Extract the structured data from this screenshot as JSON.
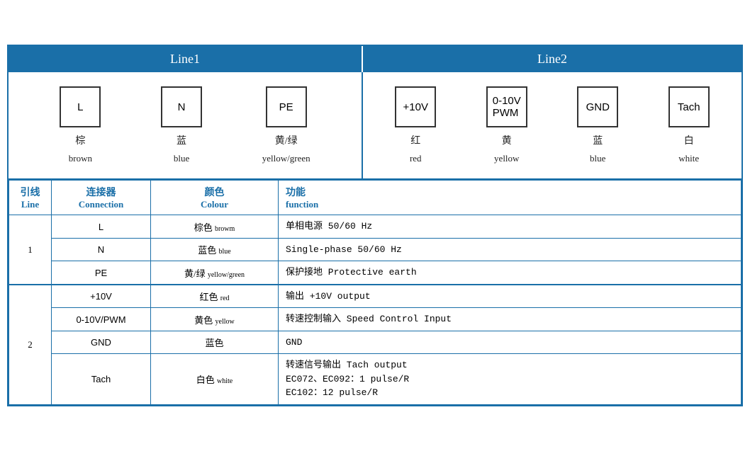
{
  "header": {
    "line1_label": "Line1",
    "line2_label": "Line2"
  },
  "diagram": {
    "line1_connectors": [
      {
        "id": "L",
        "label_zh": "棕",
        "label_en": "brown"
      },
      {
        "id": "N",
        "label_zh": "蓝",
        "label_en": "blue"
      },
      {
        "id": "PE",
        "label_zh": "黄/绿",
        "label_en": "yellow/green"
      }
    ],
    "line2_connectors": [
      {
        "id": "+10V",
        "label_zh": "红",
        "label_en": "red"
      },
      {
        "id": "0-10V\nPWM",
        "label_zh": "黄",
        "label_en": "yellow"
      },
      {
        "id": "GND",
        "label_zh": "蓝",
        "label_en": "blue"
      },
      {
        "id": "Tach",
        "label_zh": "白",
        "label_en": "white"
      }
    ]
  },
  "table": {
    "headers": {
      "line_zh": "引线",
      "line_en": "Line",
      "conn_zh": "连接器",
      "conn_en": "Connection",
      "colour_zh": "颜色",
      "colour_en": "Colour",
      "func_zh": "功能",
      "func_en": "function"
    },
    "rows": [
      {
        "group": "1",
        "rowspan": 3,
        "items": [
          {
            "conn": "L",
            "colour_zh": "棕色",
            "colour_en": "browm",
            "func": "单相电源 50/60 Hz"
          },
          {
            "conn": "N",
            "colour_zh": "蓝色",
            "colour_en": "blue",
            "func": "Single-phase 50/60 Hz"
          },
          {
            "conn": "PE",
            "colour_zh": "黄/绿",
            "colour_en": "yellow/green",
            "func": "保护接地 Protective earth"
          }
        ]
      },
      {
        "group": "2",
        "rowspan": 4,
        "items": [
          {
            "conn": "+10V",
            "colour_zh": "红色",
            "colour_en": "red",
            "func": "输出 +10V output"
          },
          {
            "conn": "0-10V/PWM",
            "colour_zh": "黄色",
            "colour_en": "yellow",
            "func": "转速控制输入 Speed Control Input"
          },
          {
            "conn": "GND",
            "colour_zh": "蓝色",
            "colour_en": "",
            "func": "GND"
          },
          {
            "conn": "Tach",
            "colour_zh": "白色",
            "colour_en": "white",
            "func": "转速信号输出 Tach output\nEC072、EC092：1 pulse/R\nEC102：12 pulse/R"
          }
        ]
      }
    ]
  }
}
